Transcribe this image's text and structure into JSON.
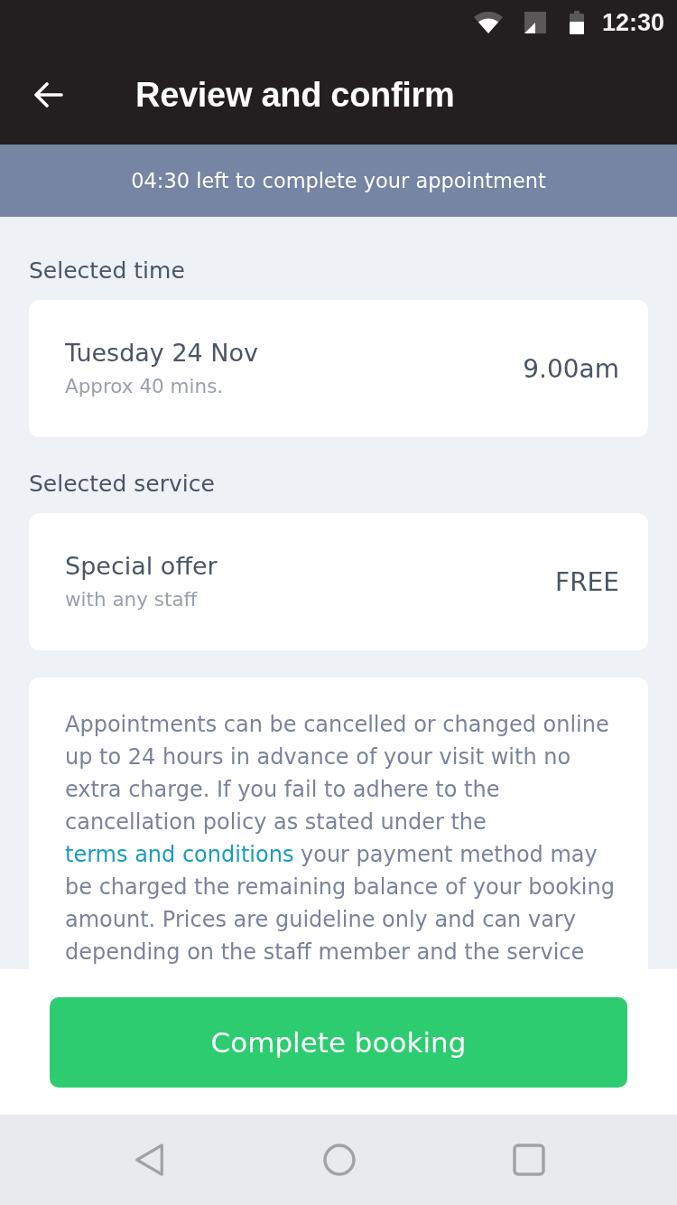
{
  "status_bar": {
    "time": "12:30"
  },
  "header": {
    "title": "Review and confirm"
  },
  "timer_banner": {
    "text": "04:30 left to complete your appointment"
  },
  "sections": [
    {
      "heading": "Selected time",
      "title": "Tuesday 24 Nov",
      "subtitle": "Approx 40 mins.",
      "value": "9.00am"
    },
    {
      "heading": "Selected service",
      "title": "Special offer",
      "subtitle": "with any staff",
      "value": "FREE"
    }
  ],
  "policy": {
    "text_before": "Appointments can be cancelled or changed online up to 24 hours in advance of your visit with no extra charge. If you fail to adhere to the cancellation policy as stated under the",
    "link": "terms and conditions",
    "text_after": "your payment method may be charged the remaining balance of your booking amount. Prices are guideline only and can vary depending on the staff member and the service"
  },
  "primary_button": {
    "label": "Complete booking"
  }
}
